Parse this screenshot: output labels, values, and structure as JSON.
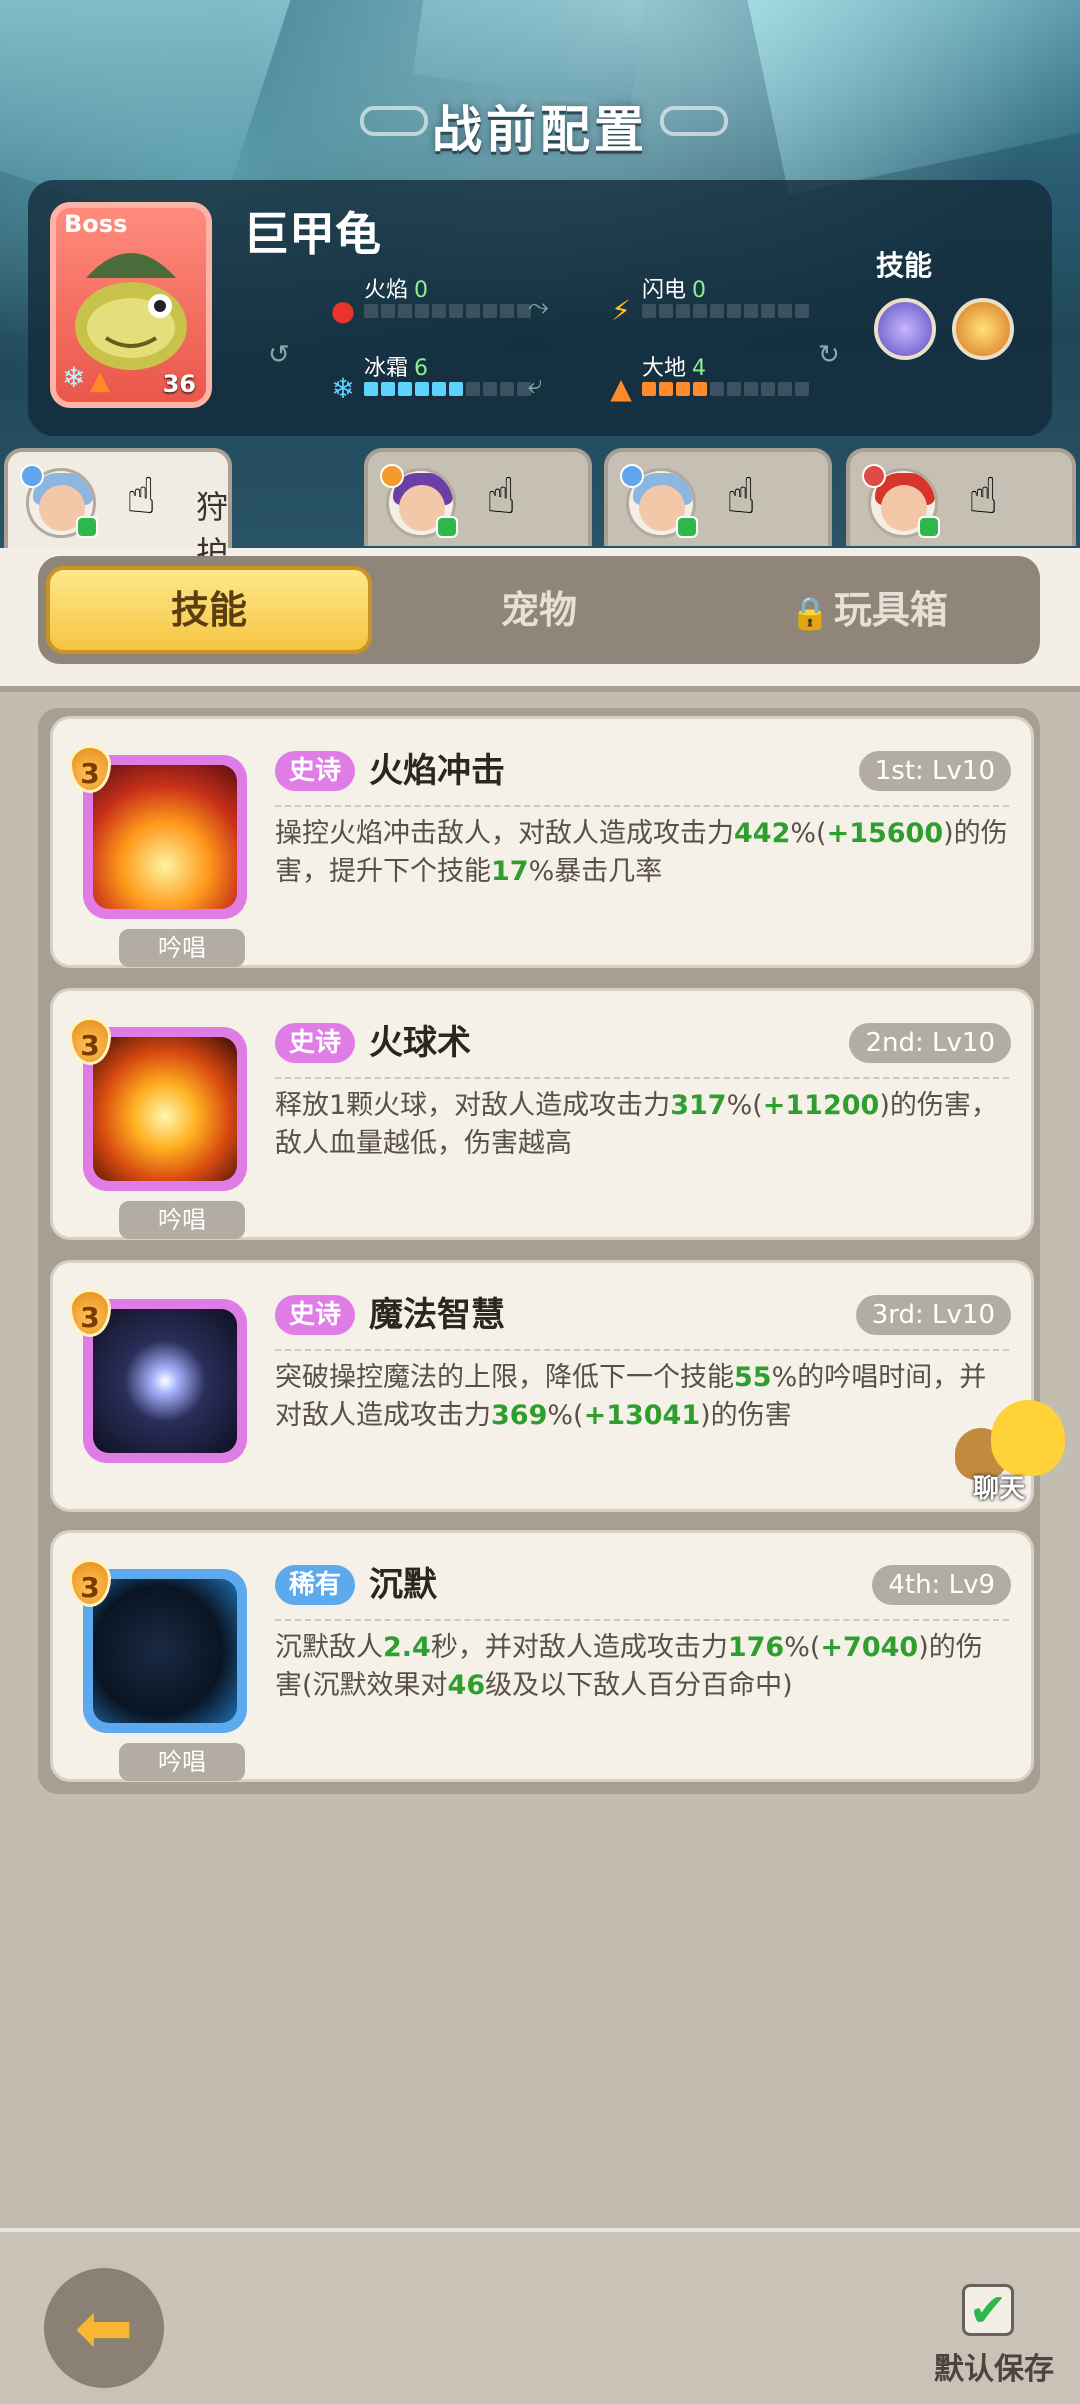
{
  "header": {
    "title": "战前配置"
  },
  "boss": {
    "tag": "Boss",
    "name": "巨甲龟",
    "level": "36",
    "stats": {
      "fire": {
        "label": "火焰",
        "value": "0",
        "level": 0
      },
      "lightning": {
        "label": "闪电",
        "value": "0",
        "level": 0
      },
      "frost": {
        "label": "冰霜",
        "value": "6",
        "level": 6
      },
      "earth": {
        "label": "大地",
        "value": "4",
        "level": 4
      }
    },
    "skills_label": "技能",
    "skill_icons": [
      "swirl-skill-icon",
      "crown-skill-icon"
    ]
  },
  "hero_tabs": [
    {
      "avatar": "blue-hair-hero",
      "label": "狩护",
      "active": true
    },
    {
      "avatar": "purple-hair-hero",
      "label": "",
      "active": false
    },
    {
      "avatar": "blue-hair-hero",
      "label": "",
      "active": false
    },
    {
      "avatar": "red-hair-hero",
      "label": "",
      "active": false
    }
  ],
  "category_tabs": [
    {
      "label": "技能",
      "active": true
    },
    {
      "label": "宠物",
      "active": false
    },
    {
      "label": "玩具箱",
      "locked": true,
      "active": false
    }
  ],
  "skills": [
    {
      "star": "3",
      "rarity": "史诗",
      "name": "火焰冲击",
      "slot": "1st: Lv10",
      "tag": "吟唱",
      "desc": [
        {
          "t": "操控火焰冲击敌人，对敌人造成攻击力"
        },
        {
          "t": "442",
          "hl": true
        },
        {
          "t": "%("
        },
        {
          "t": "+15600",
          "hl": true
        },
        {
          "t": ")的伤害，提升下个技能"
        },
        {
          "t": "17",
          "hl": true
        },
        {
          "t": "%暴击几率"
        }
      ]
    },
    {
      "star": "3",
      "rarity": "史诗",
      "name": "火球术",
      "slot": "2nd: Lv10",
      "tag": "吟唱",
      "desc": [
        {
          "t": "释放1颗火球，对敌人造成攻击力"
        },
        {
          "t": "317",
          "hl": true
        },
        {
          "t": "%("
        },
        {
          "t": "+11200",
          "hl": true
        },
        {
          "t": ")的伤害，敌人血量越低，伤害越高"
        }
      ]
    },
    {
      "star": "3",
      "rarity": "史诗",
      "name": "魔法智慧",
      "slot": "3rd: Lv10",
      "tag": "",
      "desc": [
        {
          "t": "突破操控魔法的上限，降低下一个技能"
        },
        {
          "t": "55",
          "hl": true
        },
        {
          "t": "%的吟唱时间，并对敌人造成攻击力"
        },
        {
          "t": "369",
          "hl": true
        },
        {
          "t": "%("
        },
        {
          "t": "+13041",
          "hl": true
        },
        {
          "t": ")的伤害"
        }
      ]
    },
    {
      "star": "3",
      "rarity": "稀有",
      "name": "沉默",
      "slot": "4th: Lv9",
      "tag": "吟唱",
      "desc": [
        {
          "t": "沉默敌人"
        },
        {
          "t": "2.4",
          "hl": true
        },
        {
          "t": "秒，并对敌人造成攻击力"
        },
        {
          "t": "176",
          "hl": true
        },
        {
          "t": "%("
        },
        {
          "t": "+7040",
          "hl": true
        },
        {
          "t": ")的伤害(沉默效果对"
        },
        {
          "t": "46",
          "hl": true
        },
        {
          "t": "级及以下敌人百分百命中)"
        }
      ]
    }
  ],
  "chat": {
    "label": "聊天"
  },
  "footer": {
    "save_label": "默认保存"
  },
  "colors": {
    "epic": "#e07ce6",
    "rare": "#5ca9ee",
    "highlight": "#2e9e2e",
    "accent": "#f5c542"
  }
}
